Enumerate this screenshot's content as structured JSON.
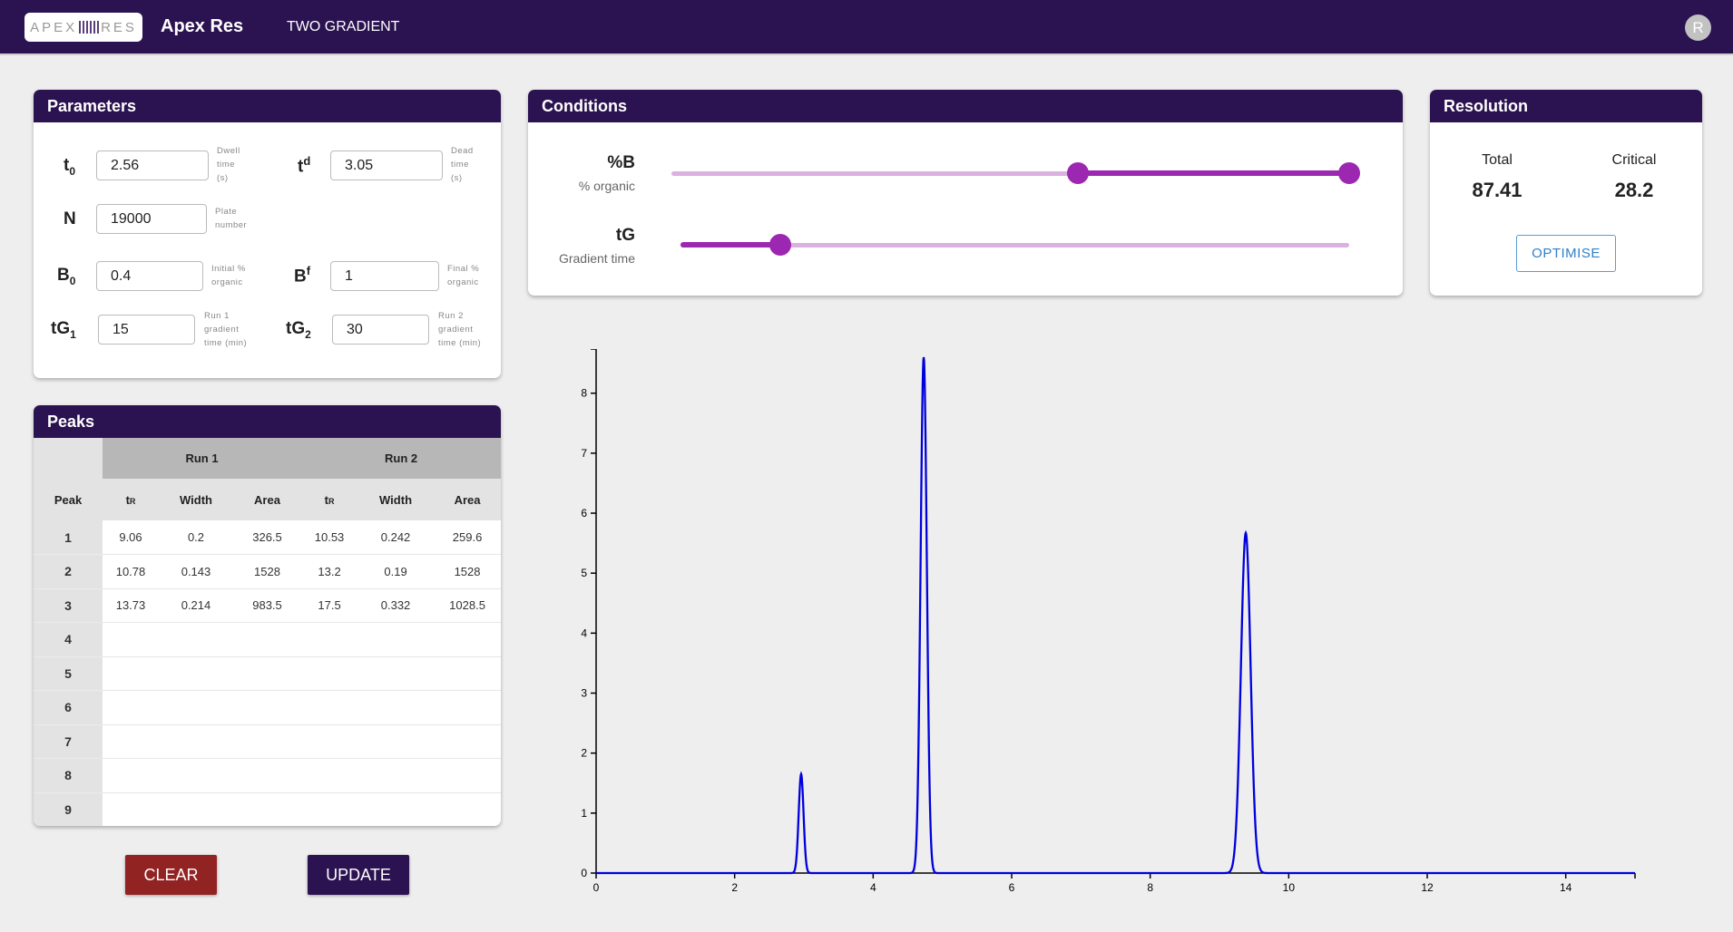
{
  "app": {
    "logo_text_left": "APEX",
    "logo_text_right": "RES",
    "title": "Apex Res",
    "nav": "TWO GRADIENT",
    "avatar_initial": "R"
  },
  "colors": {
    "brand": "#2b1250",
    "accent": "#9c27b0",
    "clear": "#922323",
    "trace": "#0000dd"
  },
  "parameters": {
    "header": "Parameters",
    "t0": {
      "label_main": "t",
      "label_sub": "0",
      "value": "2.56",
      "desc": [
        "Dwell",
        "time",
        "(s)"
      ]
    },
    "td": {
      "label_main": "t",
      "label_sup": "d",
      "value": "3.05",
      "desc": [
        "Dead",
        "time",
        "(s)"
      ]
    },
    "N": {
      "label": "N",
      "value": "19000",
      "desc": [
        "Plate",
        "number"
      ]
    },
    "B0": {
      "label_main": "B",
      "label_sub": "0",
      "value": "0.4",
      "desc": [
        "Initial %",
        "organic"
      ]
    },
    "Bf": {
      "label_main": "B",
      "label_sup": "f",
      "value": "1",
      "desc": [
        "Final %",
        "organic"
      ]
    },
    "tG1": {
      "label_main": "tG",
      "label_sub": "1",
      "value": "15",
      "desc": [
        "Run 1",
        "gradient",
        "time (min)"
      ]
    },
    "tG2": {
      "label_main": "tG",
      "label_sub": "2",
      "value": "30",
      "desc": [
        "Run 2",
        "gradient",
        "time (min)"
      ]
    }
  },
  "conditions": {
    "header": "Conditions",
    "percentB": {
      "label": "%B",
      "sub": "% organic",
      "range_low": 0.6,
      "range_high": 1.0
    },
    "tG": {
      "label": "tG",
      "sub": "Gradient time",
      "value": 0.15
    }
  },
  "resolution": {
    "header": "Resolution",
    "total_label": "Total",
    "total_value": "87.41",
    "critical_label": "Critical",
    "critical_value": "28.2",
    "optimise_label": "OPTIMISE"
  },
  "peaks": {
    "header": "Peaks",
    "run1_label": "Run 1",
    "run2_label": "Run 2",
    "columns": [
      "Peak",
      "tR",
      "Width",
      "Area",
      "tR",
      "Width",
      "Area"
    ],
    "rows": [
      {
        "peak": "1",
        "r1_tr": "9.06",
        "r1_width": "0.2",
        "r1_area": "326.5",
        "r2_tr": "10.53",
        "r2_width": "0.242",
        "r2_area": "259.6"
      },
      {
        "peak": "2",
        "r1_tr": "10.78",
        "r1_width": "0.143",
        "r1_area": "1528",
        "r2_tr": "13.2",
        "r2_width": "0.19",
        "r2_area": "1528"
      },
      {
        "peak": "3",
        "r1_tr": "13.73",
        "r1_width": "0.214",
        "r1_area": "983.5",
        "r2_tr": "17.5",
        "r2_width": "0.332",
        "r2_area": "1028.5"
      },
      {
        "peak": "4",
        "r1_tr": "",
        "r1_width": "",
        "r1_area": "",
        "r2_tr": "",
        "r2_width": "",
        "r2_area": ""
      },
      {
        "peak": "5",
        "r1_tr": "",
        "r1_width": "",
        "r1_area": "",
        "r2_tr": "",
        "r2_width": "",
        "r2_area": ""
      },
      {
        "peak": "6",
        "r1_tr": "",
        "r1_width": "",
        "r1_area": "",
        "r2_tr": "",
        "r2_width": "",
        "r2_area": ""
      },
      {
        "peak": "7",
        "r1_tr": "",
        "r1_width": "",
        "r1_area": "",
        "r2_tr": "",
        "r2_width": "",
        "r2_area": ""
      },
      {
        "peak": "8",
        "r1_tr": "",
        "r1_width": "",
        "r1_area": "",
        "r2_tr": "",
        "r2_width": "",
        "r2_area": ""
      },
      {
        "peak": "9",
        "r1_tr": "",
        "r1_width": "",
        "r1_area": "",
        "r2_tr": "",
        "r2_width": "",
        "r2_area": ""
      }
    ]
  },
  "buttons": {
    "clear": "CLEAR",
    "update": "UPDATE"
  },
  "chart_data": {
    "type": "line",
    "title": "",
    "xlabel": "",
    "ylabel": "",
    "xlim": [
      0,
      15
    ],
    "ylim": [
      0,
      8.6
    ],
    "x_ticks": [
      0,
      2,
      4,
      6,
      8,
      10,
      12,
      14
    ],
    "y_ticks": [
      0,
      1,
      2,
      3,
      4,
      5,
      6,
      7,
      8
    ],
    "series": [
      {
        "color": "#0000dd",
        "peaks": [
          {
            "center": 2.96,
            "height": 1.65,
            "sigma": 0.035
          },
          {
            "center": 4.73,
            "height": 8.6,
            "sigma": 0.045
          },
          {
            "center": 9.38,
            "height": 5.67,
            "sigma": 0.07
          }
        ]
      }
    ]
  }
}
